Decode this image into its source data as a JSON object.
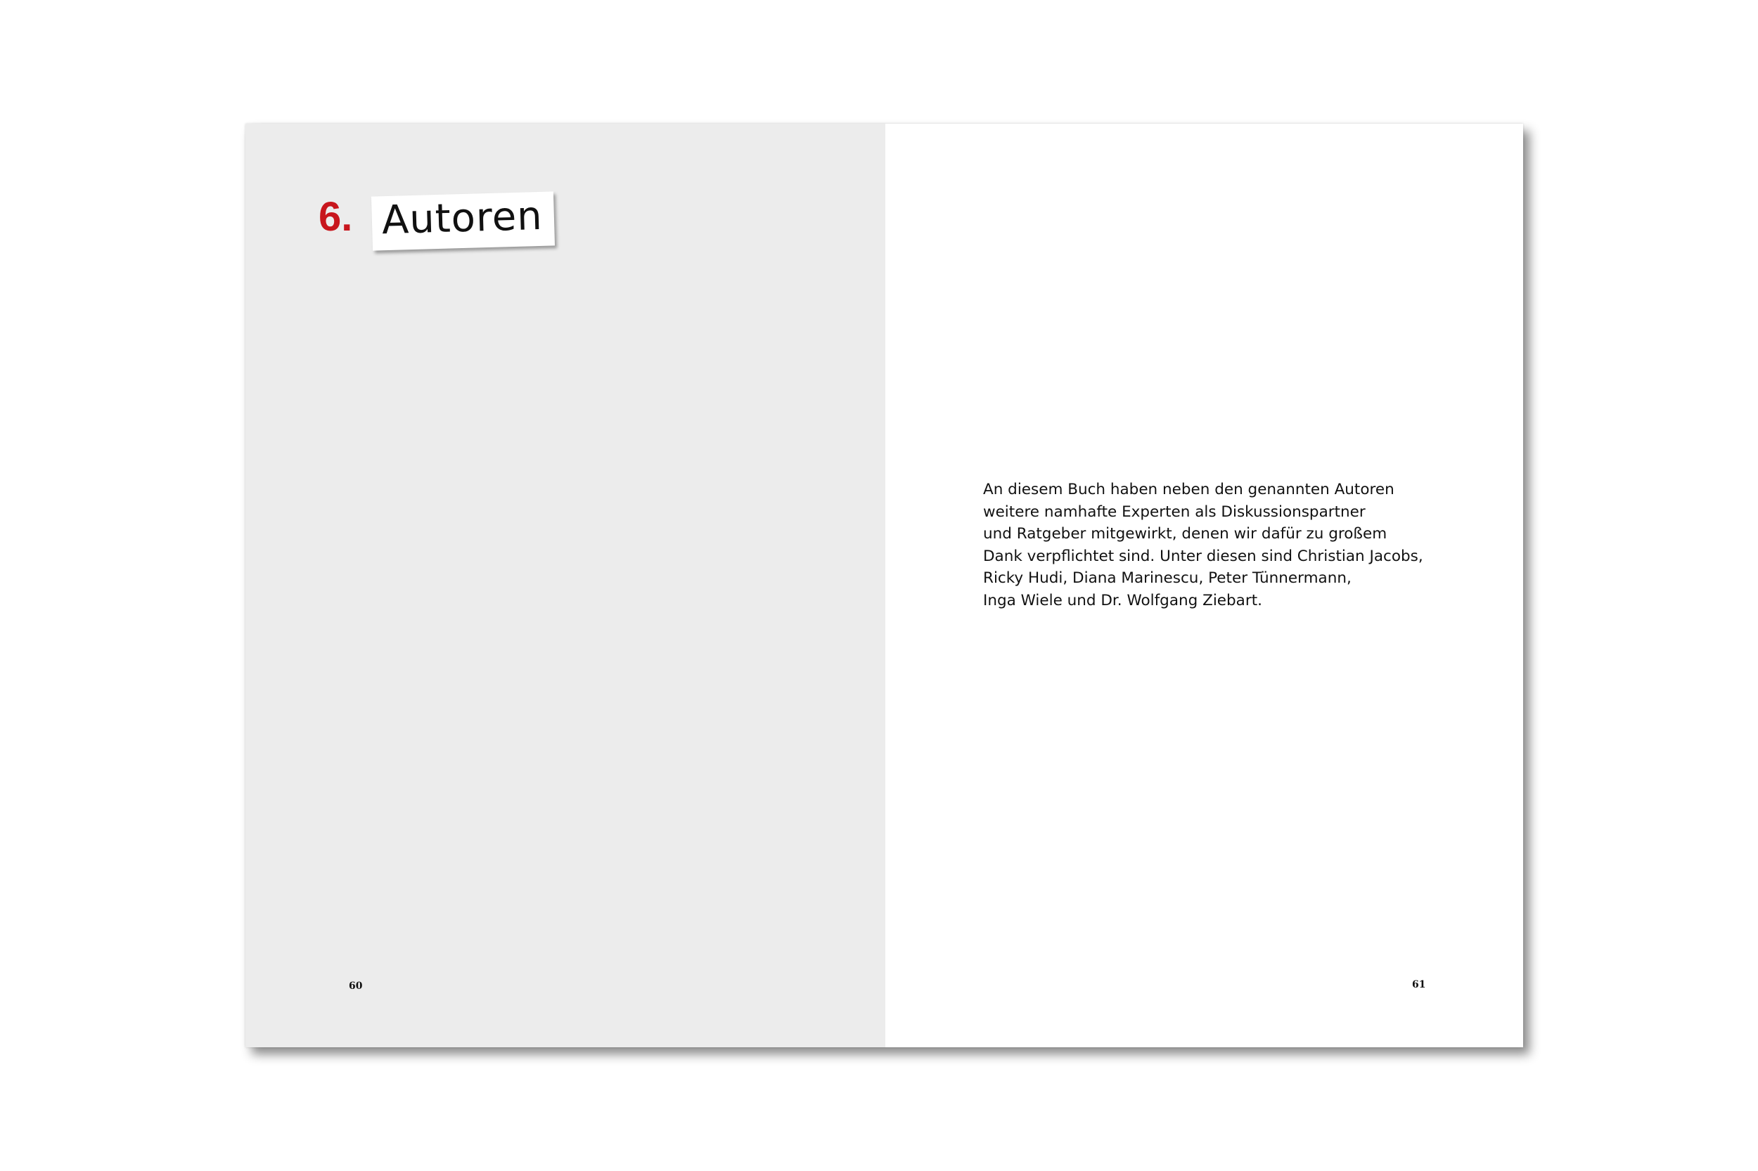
{
  "left_page": {
    "chapter_number": "6.",
    "chapter_title": "Autoren",
    "page_number": "60"
  },
  "right_page": {
    "paragraph_lines": [
      "An diesem Buch haben neben den genannten Autoren",
      "weitere namhafte Experten als Diskussionspartner",
      "und Ratgeber mitgewirkt, denen wir dafür zu großem",
      "Dank verpflichtet sind. Unter diesen sind Christian Jacobs,",
      "Ricky Hudi, Diana Marinescu, Peter Tünnermann,",
      "Inga Wiele und Dr. Wolfgang Ziebart."
    ],
    "page_number": "61"
  },
  "colors": {
    "accent_red": "#c8161d",
    "left_page_bg": "#ececec",
    "right_page_bg": "#ffffff"
  }
}
